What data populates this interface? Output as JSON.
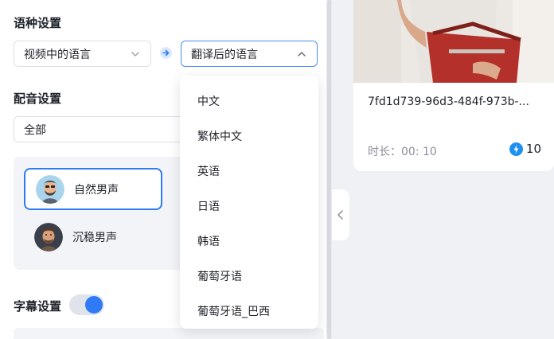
{
  "language_settings": {
    "title": "语种设置",
    "source_select": {
      "value": "视频中的语言"
    },
    "target_select": {
      "value": "翻译后的语言"
    },
    "dropdown_options": [
      "中文",
      "繁体中文",
      "英语",
      "日语",
      "韩语",
      "葡萄牙语",
      "葡萄牙语_巴西"
    ]
  },
  "dubbing_settings": {
    "title": "配音设置",
    "filter_select": {
      "value": "全部"
    },
    "voices": [
      {
        "label": "自然男声",
        "selected": true
      },
      {
        "label": "沉稳男声",
        "selected": false
      }
    ]
  },
  "subtitle_settings": {
    "title": "字幕设置",
    "toggle_on": true
  },
  "video_card": {
    "name": "7fd1d739-96d3-484f-973b-...",
    "duration": "时长：00: 10",
    "credits": "10"
  },
  "colors": {
    "accent": "#2f7bf6",
    "panel_bg": "#ffffff",
    "page_bg": "#eff1f5"
  },
  "icons": [
    "chevron-down-icon",
    "chevron-up-icon",
    "arrow-right-icon",
    "chevron-left-icon",
    "lightning-icon"
  ]
}
